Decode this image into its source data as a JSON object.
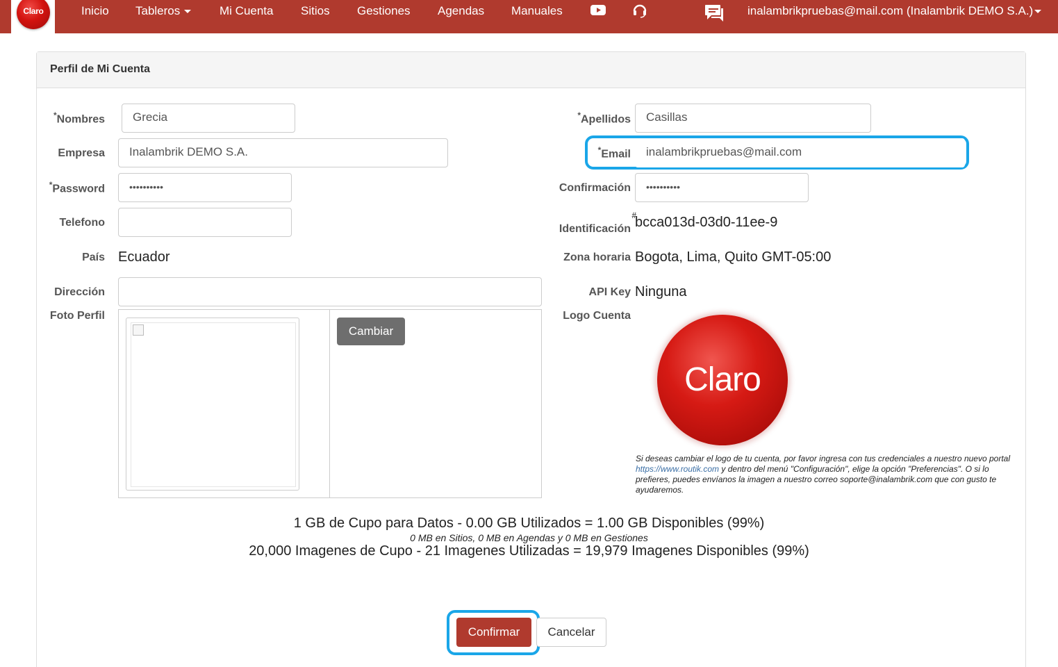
{
  "nav": {
    "brand_text": "Claro",
    "items": [
      {
        "label": "Inicio"
      },
      {
        "label": "Tableros"
      },
      {
        "label": "Mi Cuenta"
      },
      {
        "label": "Sitios"
      },
      {
        "label": "Gestiones"
      },
      {
        "label": "Agendas"
      },
      {
        "label": "Manuales"
      }
    ],
    "icons": [
      "youtube-icon",
      "headset-icon",
      "chat-icon"
    ],
    "user": "inalambrikpruebas@mail.com (Inalambrik DEMO S.A.)"
  },
  "panel": {
    "title": "Perfil de Mi Cuenta"
  },
  "form": {
    "nombres": {
      "label": "Nombres",
      "value": "Grecia"
    },
    "apellidos": {
      "label": "Apellidos",
      "value": "Casillas"
    },
    "empresa": {
      "label": "Empresa",
      "value": "Inalambrik DEMO S.A."
    },
    "email": {
      "label": "Email",
      "value": "inalambrikpruebas@mail.com"
    },
    "password": {
      "label": "Password",
      "value": "••••••••••"
    },
    "confirmacion": {
      "label": "Confirmación",
      "value": "••••••••••"
    },
    "telefono": {
      "label": "Telefono",
      "value": ""
    },
    "identificacion": {
      "label": "Identificación",
      "value": "bcca013d-03d0-11ee-9"
    },
    "pais": {
      "label": "País",
      "value": "Ecuador"
    },
    "zona_horaria": {
      "label": "Zona horaria",
      "value": "Bogota, Lima, Quito GMT-05:00"
    },
    "direccion": {
      "label": "Dirección",
      "value": ""
    },
    "api_key": {
      "label": "API Key",
      "value": "Ninguna"
    },
    "foto_perfil": {
      "label": "Foto Perfil",
      "button": "Cambiar"
    },
    "logo_cuenta": {
      "label": "Logo Cuenta",
      "logo_text": "Claro",
      "note_before": "Si deseas cambiar el logo de tu cuenta, por favor ingresa con tus credenciales a nuestro nuevo portal ",
      "note_link": "https://www.routik.com",
      "note_after": " y dentro del menú \"Configuración\", elige la opción \"Preferencias\". O si lo prefieres, puedes envíanos la imagen a nuestro correo soporte@inalambrik.com que con gusto te ayudaremos."
    }
  },
  "quota": {
    "data_line": "1 GB de Cupo para Datos - 0.00 GB Utilizados = 1.00 GB Disponibles (99%)",
    "detail_line": "0 MB en Sitios, 0 MB en Agendas y 0 MB en Gestiones",
    "images_line": "20,000 Imagenes de Cupo - 21 Imagenes Utilizadas = 19,979 Imagenes Disponibles (99%)"
  },
  "actions": {
    "confirm": "Confirmar",
    "cancel": "Cancelar"
  },
  "colors": {
    "navbar": "#b03a2e",
    "highlight": "#1aa6e8",
    "confirm_button": "#b03a2e"
  }
}
